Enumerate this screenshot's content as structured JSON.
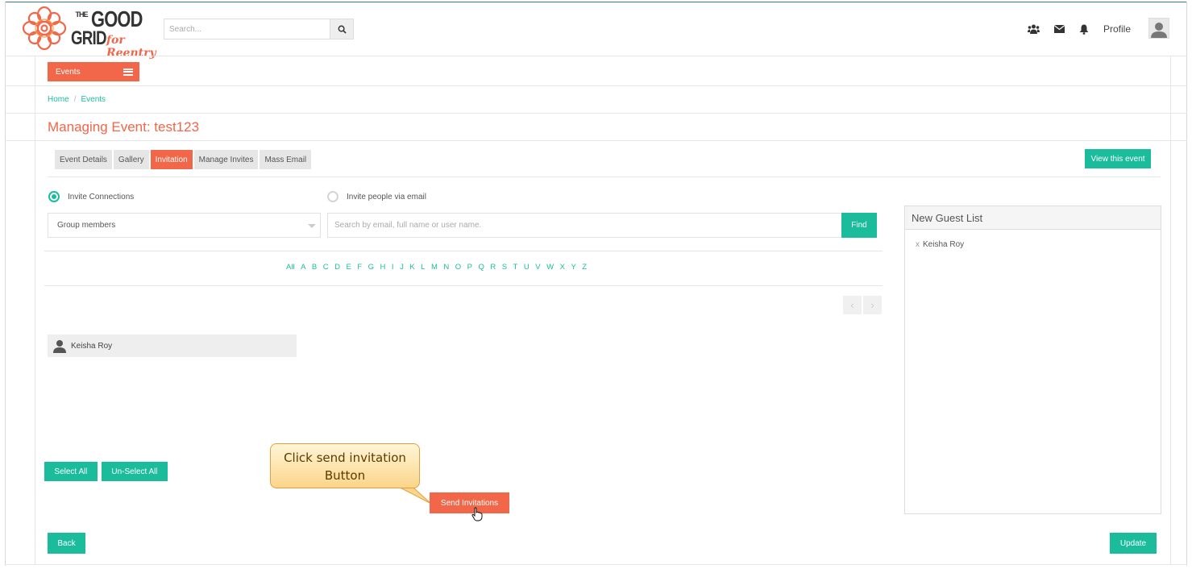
{
  "header": {
    "logo": {
      "the": "THE",
      "good": "GOOD",
      "grid": "GRID",
      "tagline": "for Reentry"
    },
    "search": {
      "placeholder": "Search..."
    },
    "profile_label": "Profile",
    "icons": [
      "users-icon",
      "envelope-icon",
      "bell-icon",
      "avatar-icon"
    ]
  },
  "menu": {
    "events_label": "Events"
  },
  "breadcrumb": {
    "home": "Home",
    "separator": "/",
    "current": "Events"
  },
  "page": {
    "title": "Managing Event: test123"
  },
  "tabs": [
    {
      "label": "Event Details",
      "active": false
    },
    {
      "label": "Gallery",
      "active": false
    },
    {
      "label": "Invitation",
      "active": true
    },
    {
      "label": "Manage Invites",
      "active": false
    },
    {
      "label": "Mass Email",
      "active": false
    }
  ],
  "view_event_label": "View this event",
  "invite": {
    "option_connections": "Invite Connections",
    "option_email": "Invite people via email",
    "selected_option": "Invite Connections",
    "group_select_value": "Group members",
    "search_placeholder": "Search by email, full name or user name.",
    "find_label": "Find"
  },
  "alphabet": [
    "All",
    "A",
    "B",
    "C",
    "D",
    "E",
    "F",
    "G",
    "H",
    "I",
    "J",
    "K",
    "L",
    "M",
    "N",
    "O",
    "P",
    "Q",
    "R",
    "S",
    "T",
    "U",
    "V",
    "W",
    "X",
    "Y",
    "Z"
  ],
  "pager": {
    "prev": "‹",
    "next": "›"
  },
  "people": [
    {
      "name": "Keisha Roy"
    }
  ],
  "guest_list": {
    "title": "New Guest List",
    "remove_glyph": "x",
    "guests": [
      {
        "name": "Keisha Roy"
      }
    ]
  },
  "actions": {
    "select_all": "Select All",
    "unselect_all": "Un-Select All",
    "send_invitations": "Send Invitations",
    "back": "Back",
    "update": "Update"
  },
  "callout": {
    "line1": "Click send invitation",
    "line2": "Button"
  },
  "colors": {
    "accent_orange": "#f26649",
    "accent_teal": "#1abc9c"
  }
}
